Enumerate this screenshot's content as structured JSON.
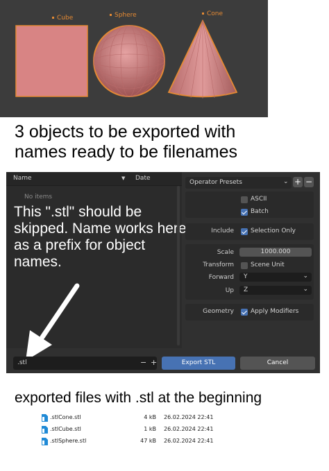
{
  "viewport": {
    "objects": [
      {
        "name": "Cube"
      },
      {
        "name": "Sphere"
      },
      {
        "name": "Cone"
      }
    ]
  },
  "caption_top": {
    "line1": "3 objects to be exported with",
    "line2": "names ready to be filenames"
  },
  "file_browser": {
    "col_name": "Name",
    "col_date": "Date",
    "empty_text": "No items",
    "overlay_note": "This \".stl\" should be skipped. Name works here as a prefix for object names.",
    "filename_value": ".stl",
    "minus_label": "−",
    "plus_label": "+"
  },
  "operator": {
    "presets_label": "Operator Presets",
    "ascii_label": "ASCII",
    "ascii_checked": false,
    "batch_label": "Batch",
    "batch_checked": true,
    "include_label": "Include",
    "selection_only_label": "Selection Only",
    "selection_only_checked": true,
    "scale_label": "Scale",
    "scale_value": "1000.000",
    "transform_label": "Transform",
    "scene_unit_label": "Scene Unit",
    "scene_unit_checked": false,
    "forward_label": "Forward",
    "forward_value": "Y",
    "up_label": "Up",
    "up_value": "Z",
    "geometry_label": "Geometry",
    "apply_modifiers_label": "Apply Modifiers",
    "apply_modifiers_checked": true
  },
  "buttons": {
    "export": "Export STL",
    "cancel": "Cancel"
  },
  "caption_bottom": "exported files with .stl at the beginning",
  "files": [
    {
      "name": ".stlCone.stl",
      "size": "4 kB",
      "date": "26.02.2024 22:41"
    },
    {
      "name": ".stlCube.stl",
      "size": "1 kB",
      "date": "26.02.2024 22:41"
    },
    {
      "name": ".stlSphere.stl",
      "size": "47 kB",
      "date": "26.02.2024 22:41"
    }
  ],
  "colors": {
    "accent_blue": "#4772b3",
    "selection_orange": "#e58a33",
    "mesh_pink": "#d88484"
  }
}
